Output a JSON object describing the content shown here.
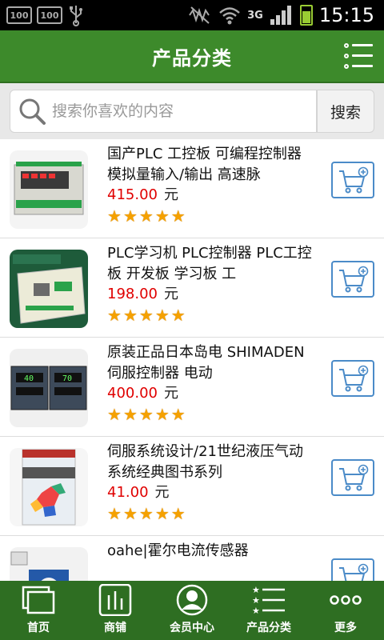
{
  "status_bar": {
    "left_badges": [
      "100",
      "100"
    ],
    "network": "3G",
    "time": "15:15",
    "battery_color": "#99cc33"
  },
  "header": {
    "title": "产品分类",
    "menu_icon": "list-menu-icon",
    "bg_color": "#3d8a2b"
  },
  "search": {
    "placeholder": "搜索你喜欢的内容",
    "button_label": "搜索",
    "icon": "search-icon"
  },
  "currency_unit": "元",
  "products": [
    {
      "title": "国产PLC 工控板 可编程控制器 模拟量输入/输出 高速脉",
      "price": "415.00",
      "rating": 5,
      "thumb": "plc-board-image"
    },
    {
      "title": "PLC学习机 PLC控制器 PLC工控板 开发板 学习板 工",
      "price": "198.00",
      "rating": 5,
      "thumb": "plc-learning-board-image"
    },
    {
      "title": "原装正品日本岛电 SHIMADEN伺服控制器 电动",
      "price": "400.00",
      "rating": 5,
      "thumb": "servo-controller-image"
    },
    {
      "title": "伺服系统设计/21世纪液压气动系统经典图书系列",
      "price": "41.00",
      "rating": 5,
      "thumb": "book-cover-image"
    },
    {
      "title": "oahe|霍尔电流传感器",
      "price": "",
      "rating": 0,
      "thumb": "hall-sensor-image"
    }
  ],
  "bottom_nav": [
    {
      "label": "首页",
      "icon": "home-window-icon"
    },
    {
      "label": "商铺",
      "icon": "shop-bars-icon",
      "active": true
    },
    {
      "label": "会员中心",
      "icon": "member-avatar-icon"
    },
    {
      "label": "产品分类",
      "icon": "category-list-icon"
    },
    {
      "label": "更多",
      "icon": "more-dots-icon"
    }
  ],
  "colors": {
    "price": "#e00000",
    "star": "#f5a100",
    "cart_border": "#4b8bc8",
    "nav_bg": "#2e6e22"
  }
}
